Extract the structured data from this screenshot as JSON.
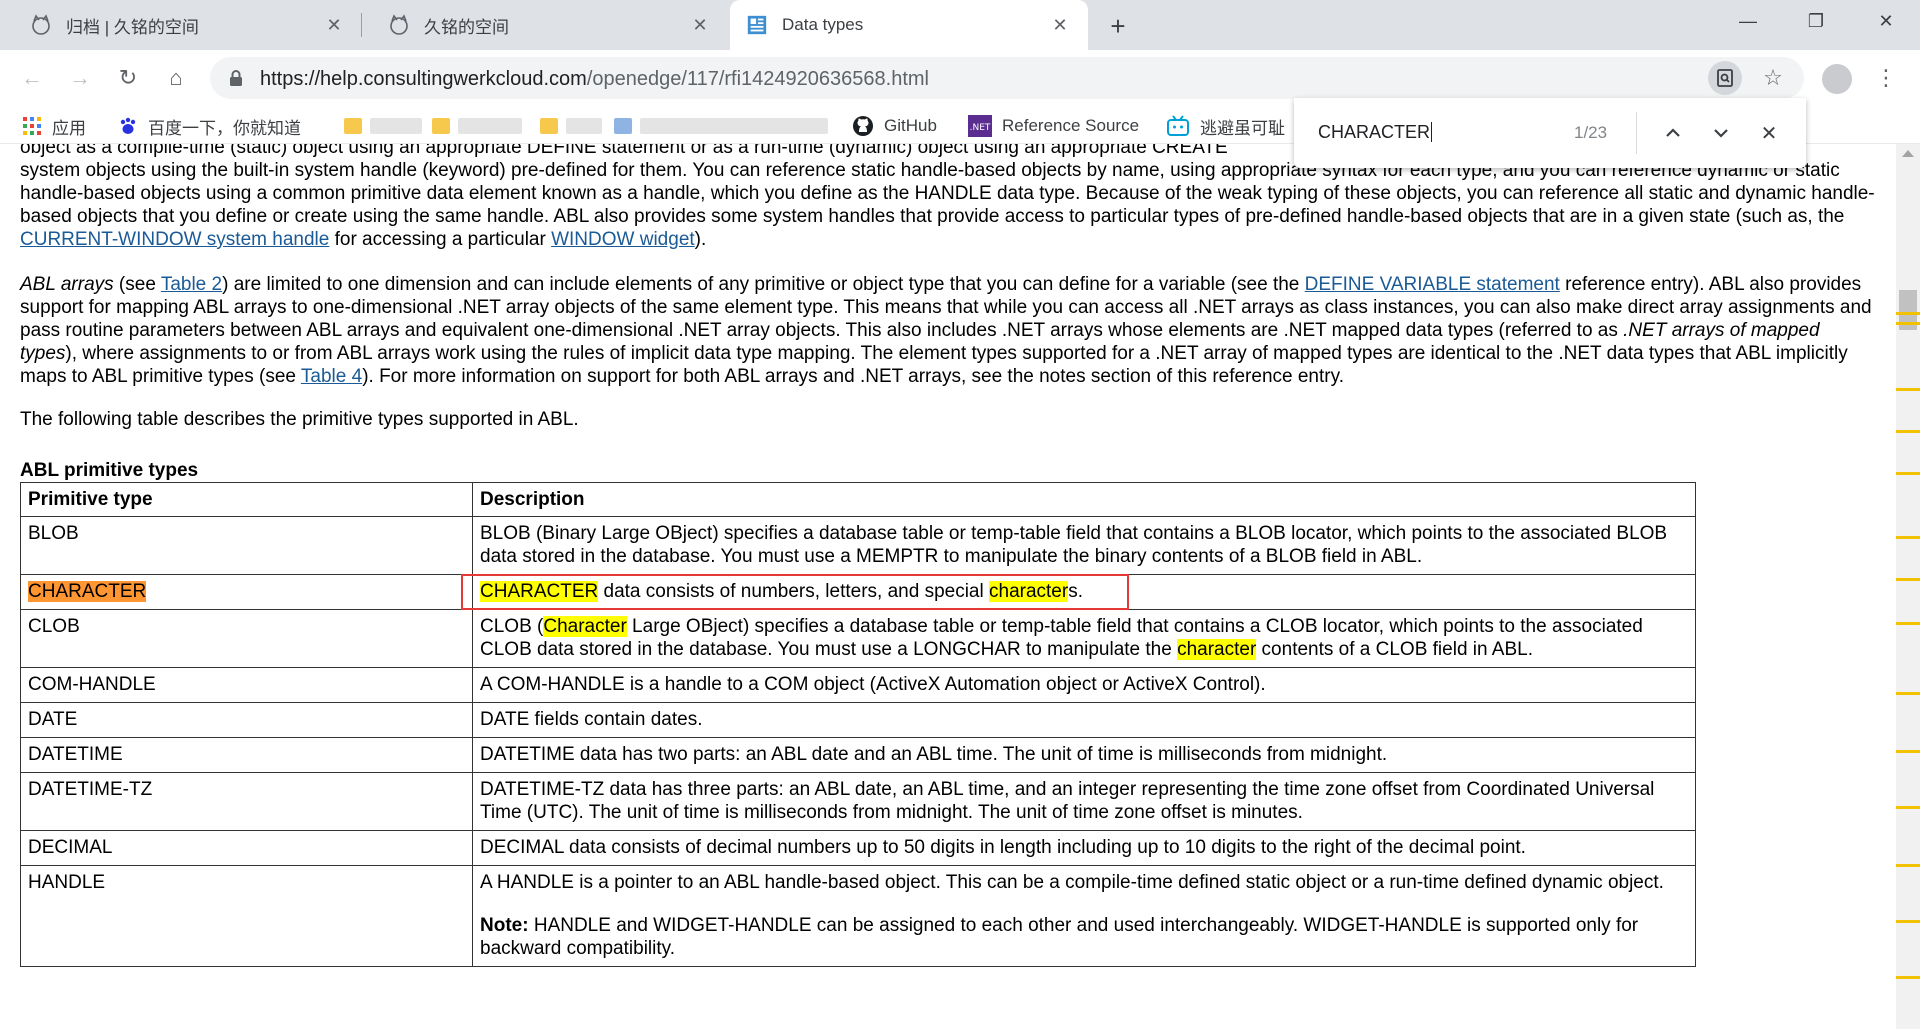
{
  "tabs": [
    {
      "title": "归档 | 久铭的空间",
      "close": "✕"
    },
    {
      "title": "久铭的空间",
      "close": "✕"
    },
    {
      "title": "Data types",
      "close": "✕"
    }
  ],
  "window_controls": {
    "minimize": "—",
    "maximize": "❐",
    "close": "✕"
  },
  "toolbar": {
    "back": "←",
    "forward": "→",
    "reload": "↻",
    "home": "⌂",
    "url_host": "https://help.consultingwerkcloud.com",
    "url_path": "/openedge/117/rfi1424920636568.html",
    "star": "☆",
    "menu": "⋮"
  },
  "bookmarks": [
    {
      "label": "应用",
      "icon": "apps-grid-icon"
    },
    {
      "label": "百度一下，你就知道",
      "icon": "baidu-paw-icon"
    },
    {
      "label": "GitHub",
      "icon": "github-icon"
    },
    {
      "label": "Reference Source",
      "icon": "dotnet-icon"
    },
    {
      "label": "逃避虽可耻",
      "icon": "bilibili-icon"
    }
  ],
  "findbar": {
    "query": "CHARACTER",
    "count": "1/23",
    "prev": "▲",
    "next": "▼",
    "close": "✕"
  },
  "content": {
    "p1_line0": "object as a compile-time (static) object using an appropriate DEFINE statement or as a run-time (dynamic) object using an appropriate CREATE",
    "p1_text_a": "system objects using the built-in system handle (keyword) pre-defined for them. You can reference static handle-based objects by name, using appropriate syntax for each type, and you can reference dynamic or static handle-based objects using a common primitive data element known as a handle, which you define as the HANDLE data type. Because of the weak typing of these objects, you can reference all static and dynamic handle-based objects that you define or create using the same handle. ABL also provides some system handles that provide access to particular types of pre-defined handle-based objects that are in a given state (such as, the ",
    "p1_link1": "CURRENT-WINDOW system handle",
    "p1_text_b": " for accessing a particular ",
    "p1_link2": "WINDOW widget",
    "p1_text_c": ").",
    "p2_em1": "ABL arrays",
    "p2_text_a": " (see ",
    "p2_link1": "Table 2",
    "p2_text_b": ") are limited to one dimension and can include elements of any primitive or object type that you can define for a variable (see the ",
    "p2_link2": "DEFINE VARIABLE statement",
    "p2_text_c": " reference entry). ABL also provides support for mapping ABL arrays to one-dimensional .NET array objects of the same element type. This means that while you can access all .NET arrays as class instances, you can also make direct array assignments and pass routine parameters between ABL arrays and equivalent one-dimensional .NET array objects. This also includes .NET arrays whose elements are .NET mapped data types (referred to as ",
    "p2_em2": ".NET arrays of mapped types",
    "p2_text_d": "), where assignments to or from ABL arrays work using the rules of implicit data type mapping. The element types supported for a .NET array of mapped types are identical to the .NET data types that ABL implicitly maps to ABL primitive types (see ",
    "p2_link3": "Table 4",
    "p2_text_e": "). For more information on support for both ABL arrays and .NET arrays, see the notes section of this reference entry.",
    "p3": "The following table describes the primitive types supported in ABL.",
    "table_caption": "ABL primitive types"
  },
  "table": {
    "headers": [
      "Primitive type",
      "Description"
    ],
    "rows": [
      {
        "type": "BLOB",
        "desc": "BLOB (Binary Large OBject) specifies a database table or temp-table field that contains a BLOB locator, which points to the associated BLOB data stored in the database. You must use a MEMPTR to manipulate the binary contents of a BLOB field in ABL."
      },
      {
        "type": "CHARACTER",
        "desc_hl1": "CHARACTER",
        "desc_a": " data consists of numbers, letters, and special ",
        "desc_hl2": "character",
        "desc_b": "s."
      },
      {
        "type": "CLOB",
        "desc_a": "CLOB (",
        "desc_hl1": "Character",
        "desc_b": " Large OBject) specifies a database table or temp-table field that contains a CLOB locator, which points to the associated CLOB data stored in the database. You must use a LONGCHAR to manipulate the ",
        "desc_hl2": "character",
        "desc_c": " contents of a CLOB field in ABL."
      },
      {
        "type": "COM-HANDLE",
        "desc": "A COM-HANDLE is a handle to a COM object (ActiveX Automation object or ActiveX Control)."
      },
      {
        "type": "DATE",
        "desc": "DATE fields contain dates."
      },
      {
        "type": "DATETIME",
        "desc": "DATETIME data has two parts: an ABL date and an ABL time. The unit of time is milliseconds from midnight."
      },
      {
        "type": "DATETIME-TZ",
        "desc": "DATETIME-TZ data has three parts: an ABL date, an ABL time, and an integer representing the time zone offset from Coordinated Universal Time (UTC). The unit of time is milliseconds from midnight. The unit of time zone offset is minutes."
      },
      {
        "type": "DECIMAL",
        "desc": "DECIMAL data consists of decimal numbers up to 50 digits in length including up to 10 digits to the right of the decimal point."
      },
      {
        "type": "HANDLE",
        "desc": "A HANDLE is a pointer to an ABL handle-based object. This can be a compile-time defined static object or a run-time defined dynamic object.",
        "note_label": "Note:",
        "note": " HANDLE and WIDGET-HANDLE can be assigned to each other and used interchangeably. WIDGET-HANDLE is supported only for backward compatibility."
      }
    ]
  },
  "colors": {
    "find_highlight": "#ffff00",
    "find_current": "#ff9632",
    "annotation_box": "#e53935",
    "link": "#1a5a96"
  }
}
